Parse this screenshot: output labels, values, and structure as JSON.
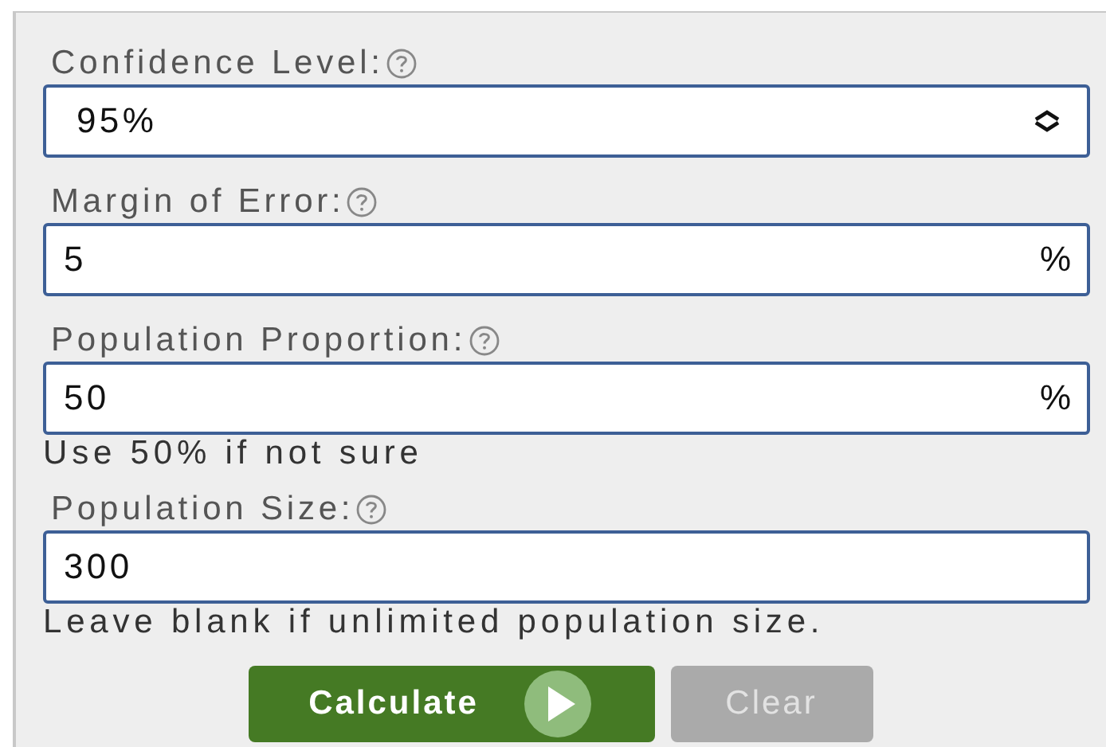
{
  "fields": [
    {
      "label": "Confidence Level:",
      "kind": "select",
      "value": "95%"
    },
    {
      "label": "Margin of Error:",
      "kind": "input",
      "value": "5",
      "suffix": "%"
    },
    {
      "label": "Population Proportion:",
      "kind": "input",
      "value": "50",
      "suffix": "%",
      "hint": "Use 50% if not sure"
    },
    {
      "label": "Population Size:",
      "kind": "input",
      "value": "300",
      "hint": "Leave blank if unlimited population size."
    }
  ],
  "buttons": [
    {
      "label": "Calculate",
      "kind": "primary"
    },
    {
      "label": "Clear",
      "kind": "secondary"
    }
  ]
}
